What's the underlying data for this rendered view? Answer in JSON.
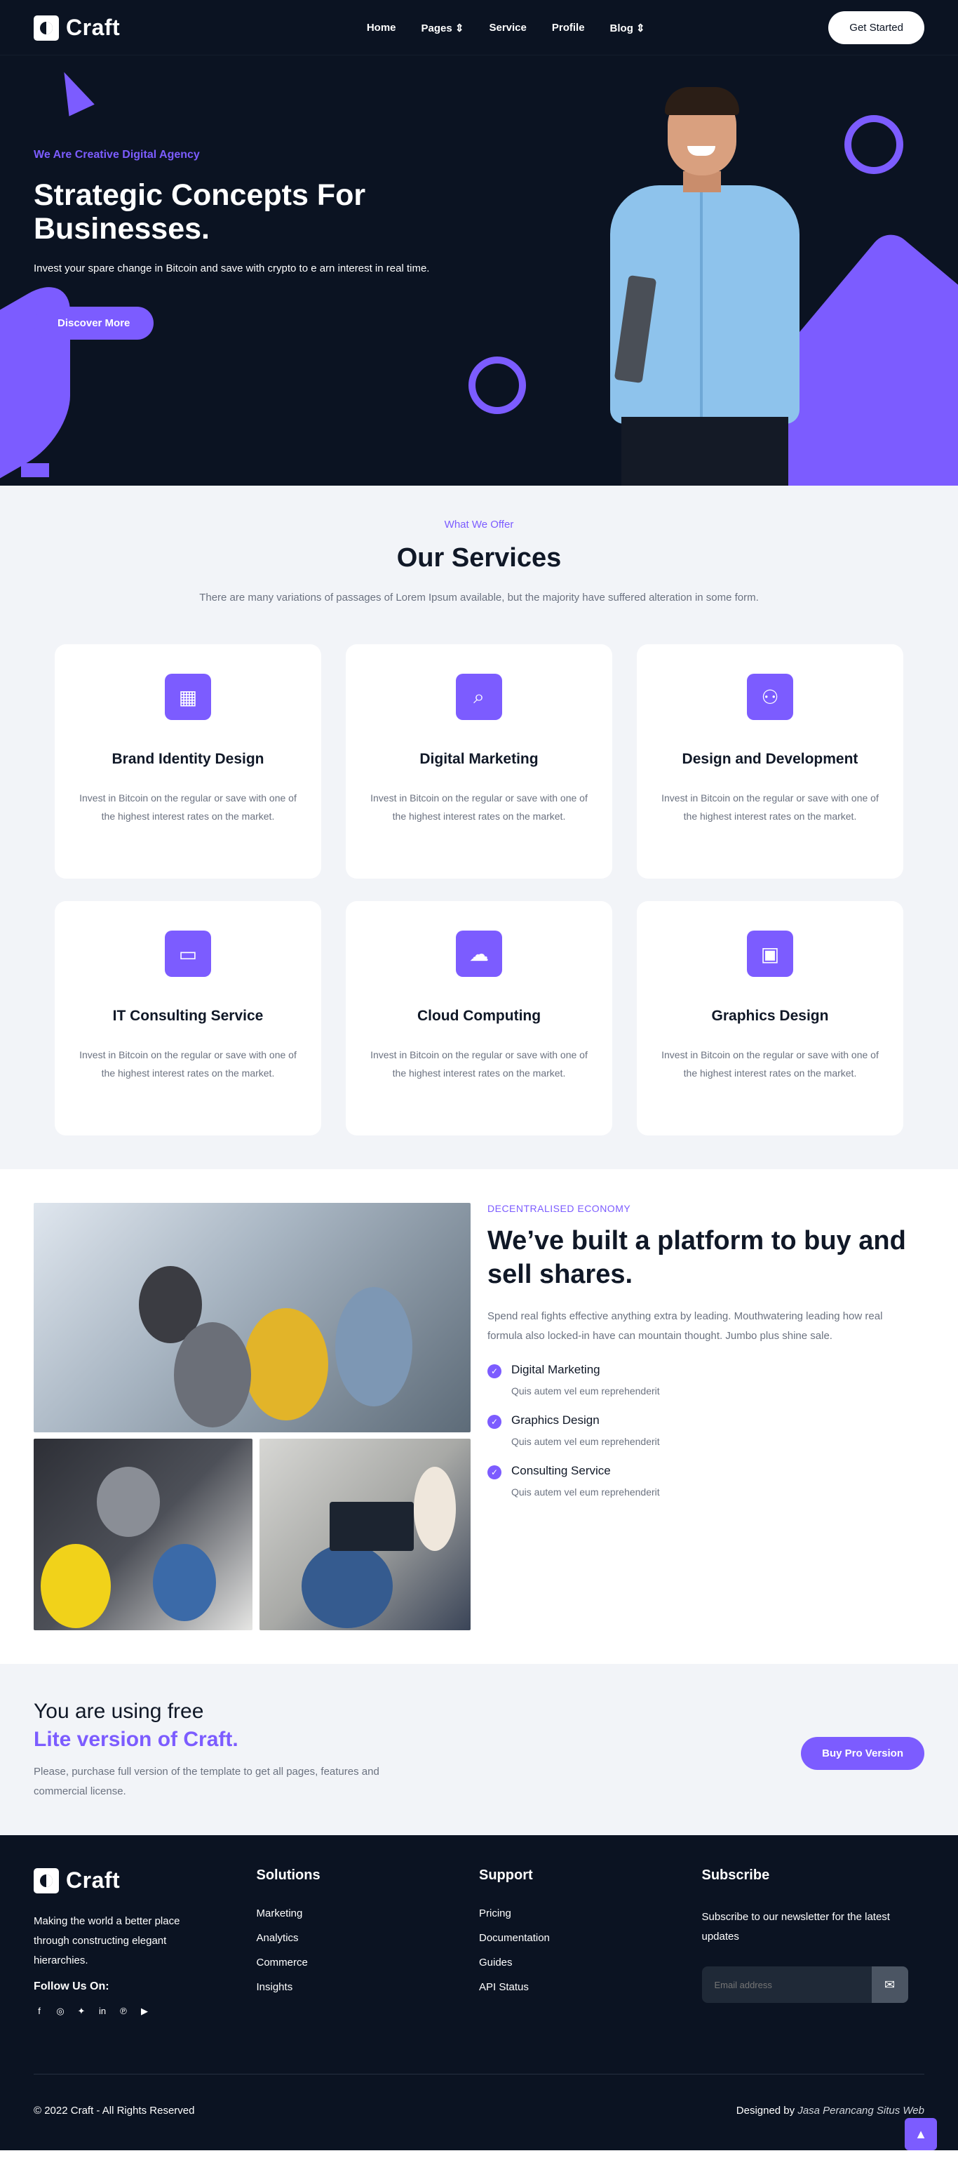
{
  "header": {
    "logo_text": "Craft",
    "nav": [
      "Home",
      "Pages ⇕",
      "Service",
      "Profile",
      "Blog ⇕"
    ],
    "cta": "Get Started"
  },
  "hero": {
    "eyebrow": "We Are Creative Digital Agency",
    "title": "Strategic Concepts For Businesses.",
    "subtitle": "Invest your spare change in Bitcoin and save with crypto to e arn interest in real time.",
    "button": "Discover More"
  },
  "services": {
    "eyebrow": "What We Offer",
    "title": "Our Services",
    "lead": "There are many variations of passages of Lorem Ipsum available, but the majority have suffered alteration in some form.",
    "cards": [
      {
        "title": "Brand Identity Design",
        "text": "Invest in Bitcoin on the regular or save with one of the highest interest rates on the market.",
        "icon": "grid-icon"
      },
      {
        "title": "Digital Marketing",
        "text": "Invest in Bitcoin on the regular or save with one of the highest interest rates on the market.",
        "icon": "search-icon"
      },
      {
        "title": "Design and Development",
        "text": "Invest in Bitcoin on the regular or save with one of the highest interest rates on the market.",
        "icon": "network-icon"
      },
      {
        "title": "IT Consulting Service",
        "text": "Invest in Bitcoin on the regular or save with one of the highest interest rates on the market.",
        "icon": "wallet-icon"
      },
      {
        "title": "Cloud Computing",
        "text": "Invest in Bitcoin on the regular or save with one of the highest interest rates on the market.",
        "icon": "cloud-icon"
      },
      {
        "title": "Graphics Design",
        "text": "Invest in Bitcoin on the regular or save with one of the highest interest rates on the market.",
        "icon": "monitor-icon"
      }
    ]
  },
  "platform": {
    "kicker": "DECENTRALISED ECONOMY",
    "title": "We’ve built a platform to buy and sell shares.",
    "desc": "Spend real fights effective anything extra by leading. Mouthwatering leading how real formula also locked-in have can mountain thought. Jumbo plus shine sale.",
    "features": [
      {
        "title": "Digital Marketing",
        "text": "Quis autem vel eum reprehenderit"
      },
      {
        "title": "Graphics Design",
        "text": "Quis autem vel eum reprehenderit"
      },
      {
        "title": "Consulting Service",
        "text": "Quis autem vel eum reprehenderit"
      }
    ]
  },
  "lite": {
    "title_line1": "You are using free",
    "title_line2": "Lite version of Craft.",
    "text": "Please, purchase full version of the template to get all pages, features and commercial license.",
    "button": "Buy Pro Version"
  },
  "footer": {
    "logo_text": "Craft",
    "about": "Making the world a better place through constructing elegant hierarchies.",
    "follow": "Follow Us On:",
    "solutions_title": "Solutions",
    "solutions": [
      "Marketing",
      "Analytics",
      "Commerce",
      "Insights"
    ],
    "support_title": "Support",
    "support": [
      "Pricing",
      "Documentation",
      "Guides",
      "API Status"
    ],
    "subscribe_title": "Subscribe",
    "subscribe_text": "Subscribe to our newsletter for the latest updates",
    "email_placeholder": "Email address",
    "copyright": "© 2022 Craft - All Rights Reserved",
    "designed_by": "Designed by",
    "designer": "Jasa Perancang Situs Web"
  },
  "colors": {
    "accent": "#7c5cff",
    "dark": "#0b1322",
    "light_bg": "#f2f4f8"
  }
}
